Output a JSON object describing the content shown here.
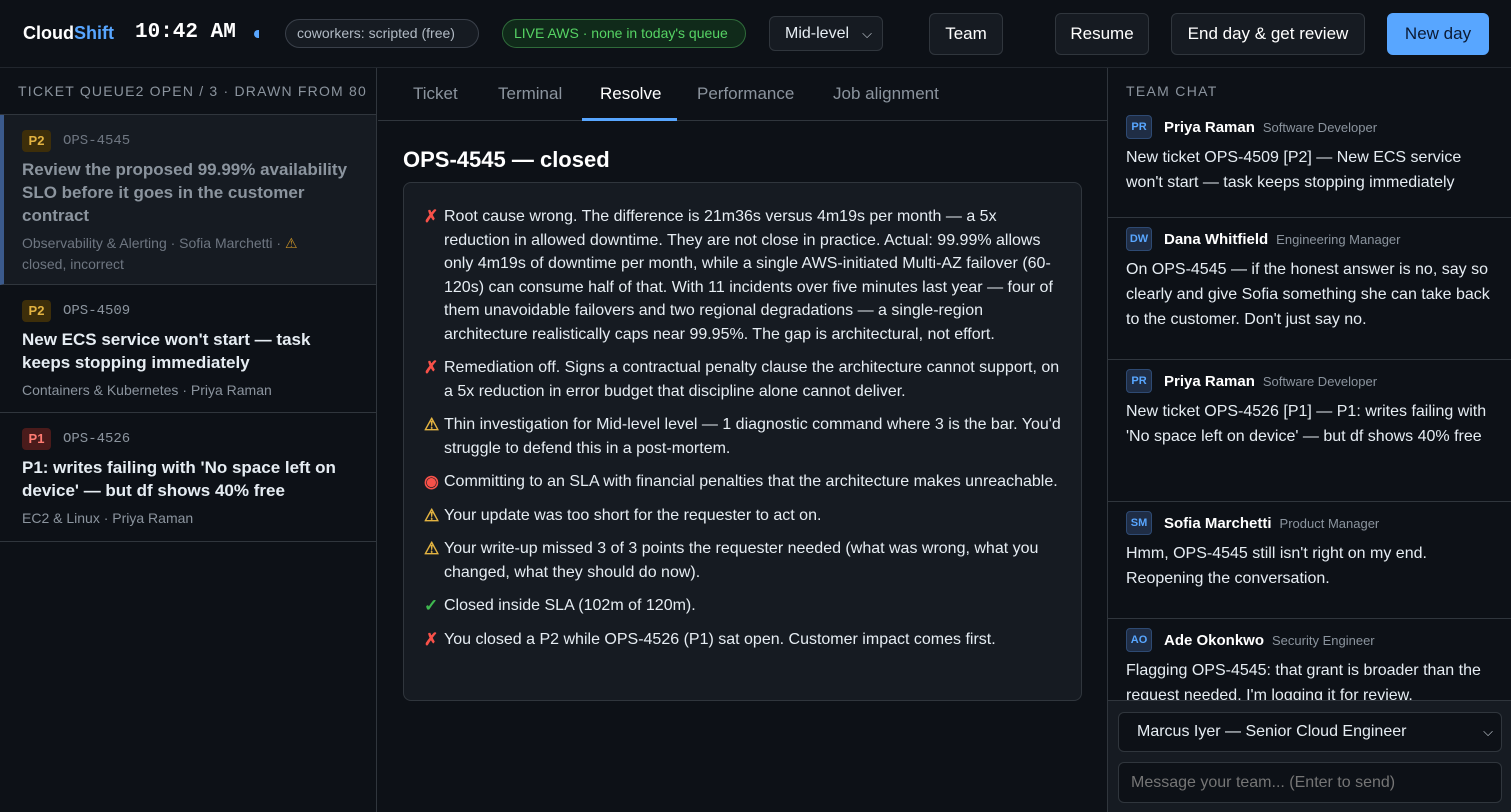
{
  "app": {
    "brand_main": "Cloud",
    "brand_accent": "Shift",
    "clock": "10:42 AM",
    "coworkers_pill": "coworkers: scripted (free)",
    "live_pill": "LIVE AWS · none in today's queue",
    "level_select": "Mid-level",
    "buttons": {
      "team": "Team",
      "resume": "Resume",
      "end_day": "End day & get review",
      "new_day": "New day"
    }
  },
  "queue": {
    "header": "TICKET QUEUE2 OPEN / 3 · DRAWN FROM 80",
    "tickets": [
      {
        "priority": "P2",
        "id": "OPS-4545",
        "title": "Review the proposed 99.99% availability SLO before it goes in the customer contract",
        "meta": "Observability & Alerting · Sofia Marchetti · ",
        "status": "closed, incorrect",
        "icon": "warning-icon"
      },
      {
        "priority": "P2",
        "id": "OPS-4509",
        "title": "New ECS service won't start — task keeps stopping immediately",
        "meta": "Containers & Kubernetes · Priya Raman"
      },
      {
        "priority": "P1",
        "id": "OPS-4526",
        "title": "P1: writes failing with 'No space left on device' — but df shows 40% free",
        "meta": "EC2 & Linux · Priya Raman"
      }
    ]
  },
  "tabs": [
    "Ticket",
    "Terminal",
    "Resolve",
    "Performance",
    "Job alignment"
  ],
  "active_tab": "Resolve",
  "resolve": {
    "title": "OPS-4545 — closed",
    "feedback": [
      {
        "icon": "cross-icon",
        "glyph": "✗",
        "text": "Root cause wrong. The difference is 21m36s versus 4m19s per month — a 5x reduction in allowed downtime. They are not close in practice. Actual: 99.99% allows only 4m19s of downtime per month, while a single AWS-initiated Multi-AZ failover (60-120s) can consume half of that. With 11 incidents over five minutes last year — four of them unavoidable failovers and two regional degradations — a single-region architecture realistically caps near 99.95%. The gap is architectural, not effort."
      },
      {
        "icon": "cross-icon",
        "glyph": "✗",
        "text": "Remediation off. Signs a contractual penalty clause the architecture cannot support, on a 5x reduction in error budget that discipline alone cannot deliver."
      },
      {
        "icon": "warning-icon",
        "glyph": "⚠",
        "text": "Thin investigation for Mid-level level — 1 diagnostic command where 3 is the bar. You'd struggle to defend this in a post-mortem."
      },
      {
        "icon": "siren-icon",
        "glyph": "◉",
        "text": "Committing to an SLA with financial penalties that the architecture makes unreachable."
      },
      {
        "icon": "warning-icon",
        "glyph": "⚠",
        "text": "Your update was too short for the requester to act on."
      },
      {
        "icon": "warning-icon",
        "glyph": "⚠",
        "text": "Your write-up missed 3 of 3 points the requester needed (what was wrong, what you changed, what they should do now)."
      },
      {
        "icon": "check-icon",
        "glyph": "✓",
        "text": "Closed inside SLA (102m of 120m)."
      },
      {
        "icon": "cross-icon",
        "glyph": "✗",
        "text": "You closed a P2 while OPS-4526 (P1) sat open. Customer impact comes first."
      }
    ]
  },
  "chat": {
    "header": "TEAM CHAT",
    "messages": [
      {
        "initials": "PR",
        "name": "Priya Raman",
        "role": "Software Developer",
        "text": "New ticket OPS-4509 [P2] — New ECS service won't start — task keeps stopping immediately"
      },
      {
        "initials": "DW",
        "name": "Dana Whitfield",
        "role": "Engineering Manager",
        "text": "On OPS-4545 — if the honest answer is no, say so clearly and give Sofia something she can take back to the customer. Don't just say no."
      },
      {
        "initials": "PR",
        "name": "Priya Raman",
        "role": "Software Developer",
        "text": "New ticket OPS-4526 [P1] — P1: writes failing with 'No space left on device' — but df shows 40% free"
      },
      {
        "initials": "SM",
        "name": "Sofia Marchetti",
        "role": "Product Manager",
        "text": "Hmm, OPS-4545 still isn't right on my end. Reopening the conversation."
      },
      {
        "initials": "AO",
        "name": "Ade Okonkwo",
        "role": "Security Engineer",
        "text": "Flagging OPS-4545: that grant is broader than the request needed. I'm logging it for review."
      }
    ],
    "persona_select": "Marcus Iyer — Senior Cloud Engineer",
    "composer_placeholder": "Message your team... (Enter to send)"
  },
  "colors": {
    "accent": "#58a6ff",
    "background": "#0d1117",
    "panel": "#161b22",
    "live_green": "#56d364",
    "error_red": "#f85149",
    "warning_amber": "#e3b341"
  }
}
